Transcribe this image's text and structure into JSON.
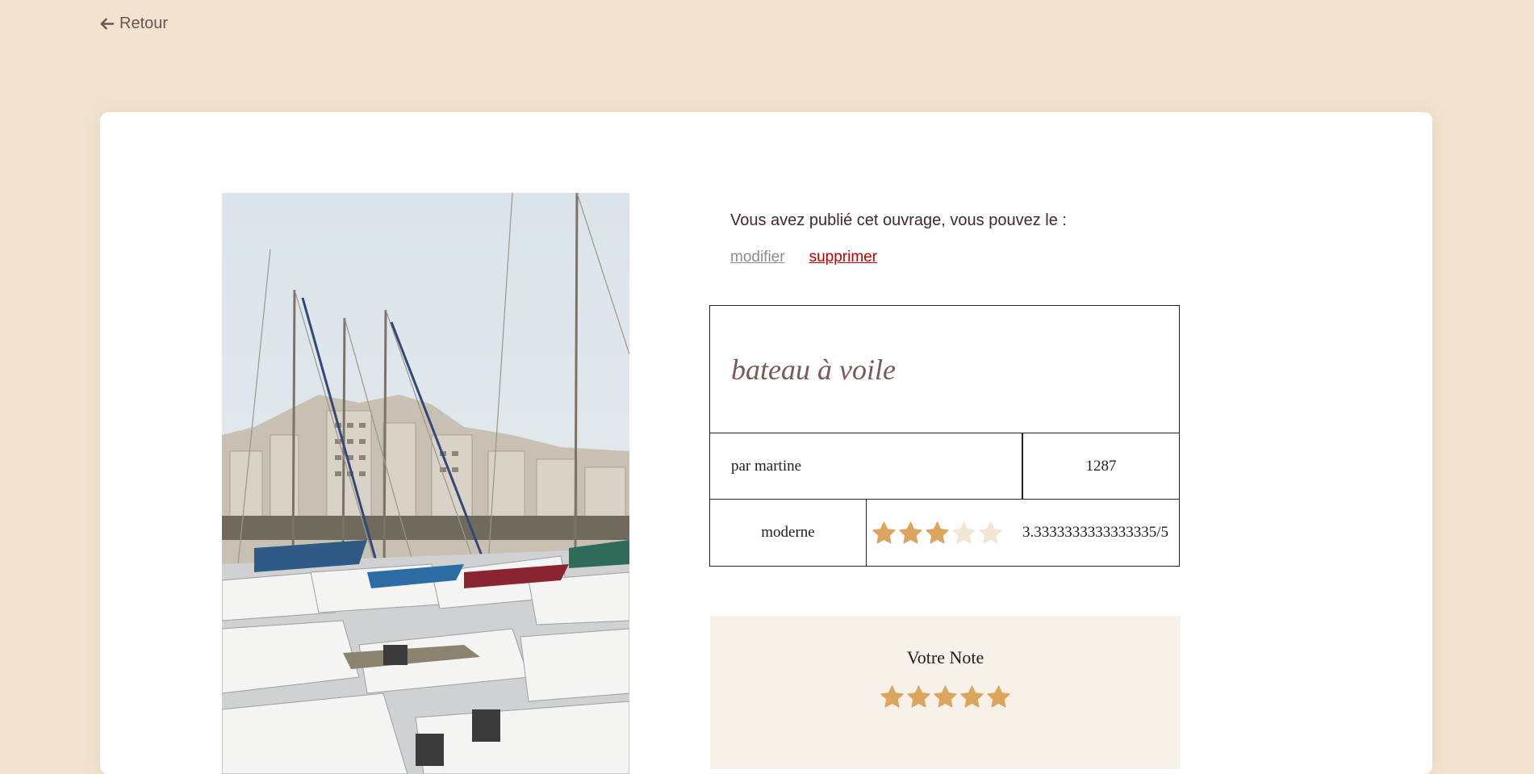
{
  "nav": {
    "back_label": "Retour"
  },
  "artwork": {
    "image_name": "sailboats-harbor-photo",
    "owner_message": "Vous avez publié cet ouvrage, vous pouvez le :",
    "edit_label": "modifier",
    "delete_label": "supprimer",
    "title": "bateau à voile",
    "author": "par martine",
    "views": "1287",
    "style": "moderne",
    "rating": {
      "value_text": "3.3333333333333335/5",
      "filled_stars": 3,
      "total_stars": 5
    }
  },
  "vote": {
    "title": "Votre Note",
    "filled_stars": 5,
    "total_stars": 5
  },
  "colors": {
    "background": "#f2e3cf",
    "star_filled": "#dba55e",
    "star_empty": "#f3e6d4",
    "delete": "#c00000",
    "edit": "#8c8c8c"
  }
}
